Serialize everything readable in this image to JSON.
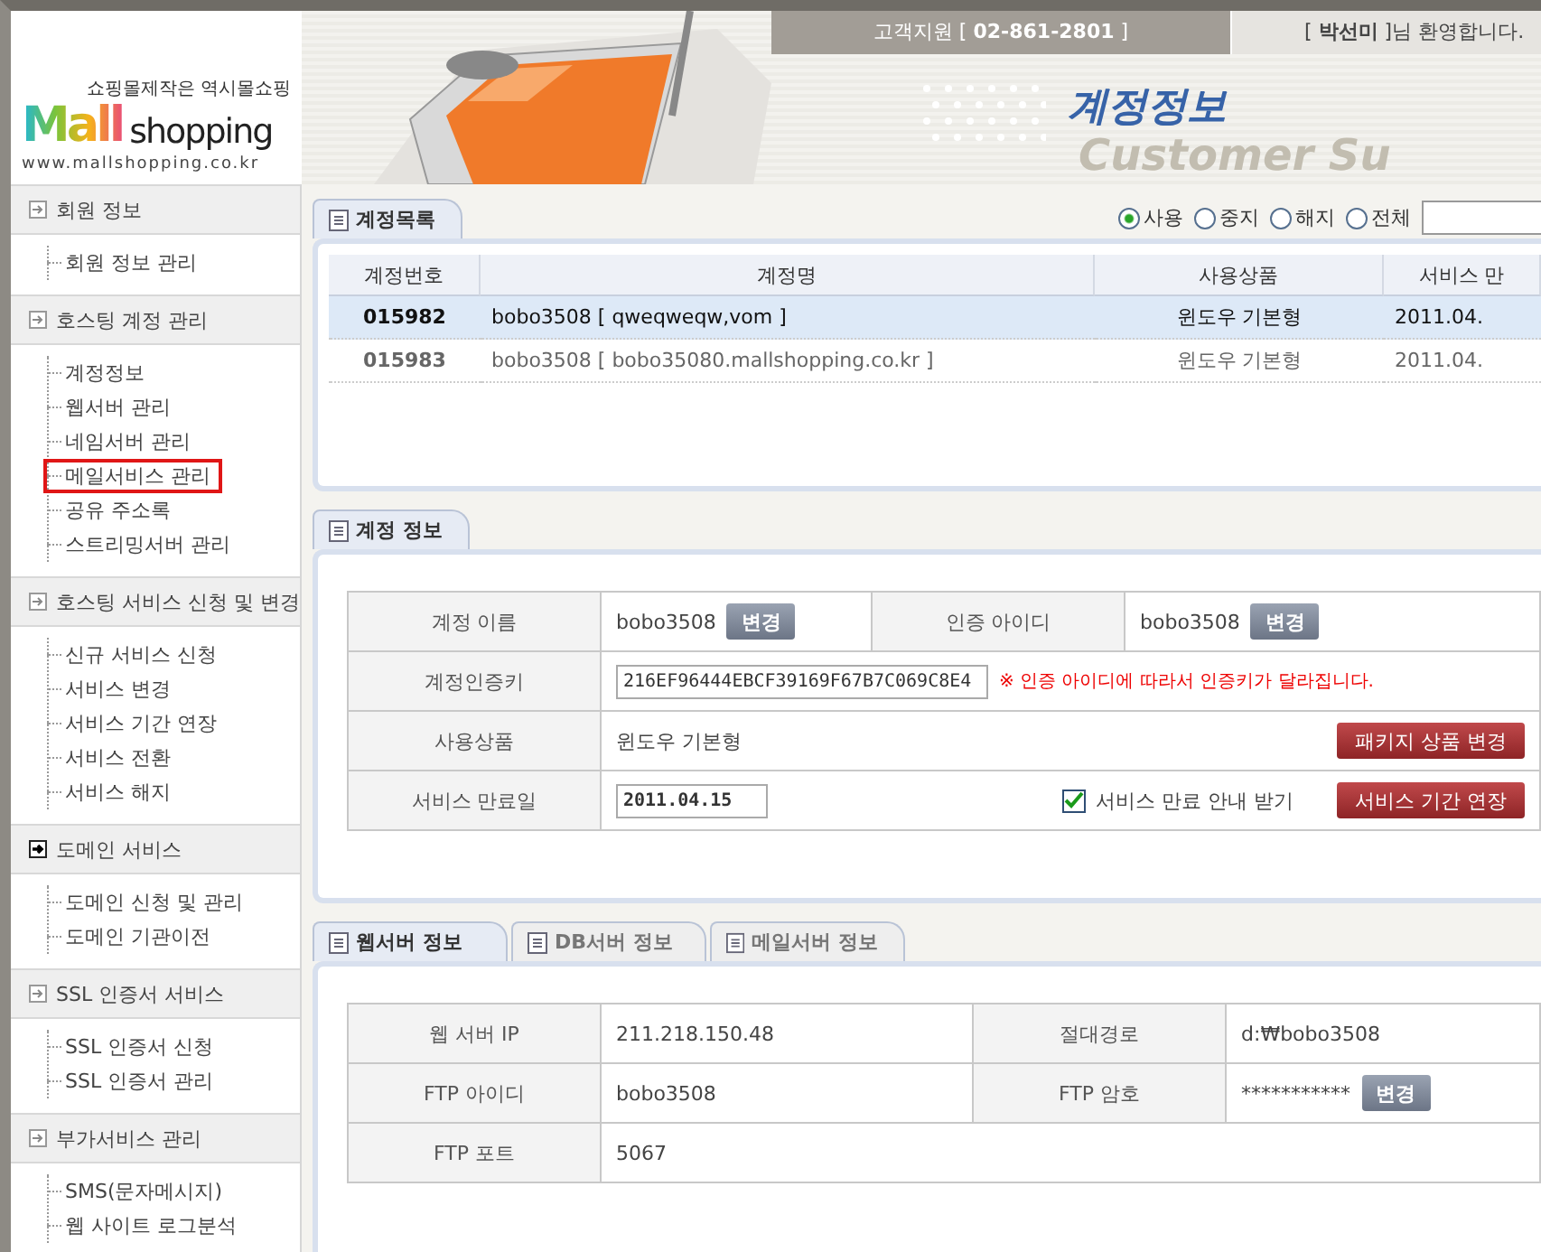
{
  "top_bar": {
    "support": "고객지원 [ **02-861-2801** ]",
    "welcome": "[ **박선미** ]님 환영합니다."
  },
  "logo": {
    "tagline": "쇼핑몰제작은 역시몰쇼핑",
    "word_1": "Mall",
    "word_2": "shopping",
    "url": "www.mallshopping.co.kr"
  },
  "header": {
    "title": "계정정보",
    "subtitle": "Customer Su"
  },
  "sidebar": {
    "sections": [
      {
        "title": "회원 정보",
        "selected": false,
        "items": [
          {
            "label": "회원 정보 관리",
            "selected": false
          }
        ]
      },
      {
        "title": "호스팅 계정 관리",
        "selected": false,
        "items": [
          {
            "label": "계정정보",
            "selected": false
          },
          {
            "label": "웹서버 관리",
            "selected": false
          },
          {
            "label": "네임서버 관리",
            "selected": false
          },
          {
            "label": "메일서비스 관리",
            "selected": true
          },
          {
            "label": "공유 주소록",
            "selected": false
          },
          {
            "label": "스트리밍서버 관리",
            "selected": false
          }
        ]
      },
      {
        "title": "호스팅 서비스 신청 및 변경",
        "selected": false,
        "items": [
          {
            "label": "신규 서비스 신청",
            "selected": false
          },
          {
            "label": "서비스 변경",
            "selected": false
          },
          {
            "label": "서비스 기간 연장",
            "selected": false
          },
          {
            "label": "서비스 전환",
            "selected": false
          },
          {
            "label": "서비스 해지",
            "selected": false
          }
        ]
      },
      {
        "title": "도메인 서비스",
        "selected": true,
        "items": [
          {
            "label": "도메인 신청 및 관리",
            "selected": false
          },
          {
            "label": "도메인 기관이전",
            "selected": false
          }
        ]
      },
      {
        "title": "SSL 인증서 서비스",
        "selected": false,
        "items": [
          {
            "label": "SSL 인증서 신청",
            "selected": false
          },
          {
            "label": "SSL 인증서 관리",
            "selected": false
          }
        ]
      },
      {
        "title": "부가서비스 관리",
        "selected": false,
        "items": [
          {
            "label": "SMS(문자메시지)",
            "selected": false
          },
          {
            "label": "웹 사이트 로그분석",
            "selected": false
          }
        ]
      }
    ]
  },
  "account_list": {
    "tab": "계정목록",
    "filters": [
      {
        "label": "사용",
        "selected": true
      },
      {
        "label": "중지",
        "selected": false
      },
      {
        "label": "해지",
        "selected": false
      },
      {
        "label": "전체",
        "selected": false
      }
    ],
    "columns": [
      "계정번호",
      "계정명",
      "사용상품",
      "서비스 만"
    ],
    "rows": [
      {
        "number": "015982",
        "name": "bobo3508 [ qweqweqw,vom ]",
        "product": "윈도우 기본형",
        "expiry": "2011.04.",
        "selected": true
      },
      {
        "number": "015983",
        "name": "bobo3508 [ bobo35080.mallshopping.co.kr ]",
        "product": "윈도우 기본형",
        "expiry": "2011.04.",
        "selected": false
      }
    ]
  },
  "account_info": {
    "tab": "계정 정보",
    "account_name": {
      "label": "계정 이름",
      "value": "bobo3508",
      "button": "변경"
    },
    "auth_id": {
      "label": "인증 아이디",
      "value": "bobo3508",
      "button": "변경"
    },
    "auth_key": {
      "label": "계정인증키",
      "value": "216EF96444EBCF39169F67B7C069C8E4",
      "note": "※ 인증 아이디에 따라서 인증키가 달라집니다."
    },
    "product": {
      "label": "사용상품",
      "value": "윈도우 기본형",
      "button": "패키지 상품 변경"
    },
    "expiry": {
      "label": "서비스 만료일",
      "value": "2011.04.15",
      "notice_label": "서비스 만료 안내 받기",
      "notice_checked": true,
      "button": "서비스 기간 연장"
    }
  },
  "server_info": {
    "tabs": [
      {
        "label": "웹서버 정보",
        "selected": true
      },
      {
        "label": "DB서버 정보",
        "selected": false
      },
      {
        "label": "메일서버 정보",
        "selected": false
      }
    ],
    "web_ip": {
      "label": "웹 서버 IP",
      "value": "211.218.150.48"
    },
    "path": {
      "label": "절대경로",
      "value": "d:₩bobo3508"
    },
    "ftp_id": {
      "label": "FTP 아이디",
      "value": "bobo3508"
    },
    "ftp_password": {
      "label": "FTP 암호",
      "value": "***********",
      "button": "변경"
    },
    "ftp_port": {
      "label": "FTP 포트",
      "value": "5067"
    }
  }
}
